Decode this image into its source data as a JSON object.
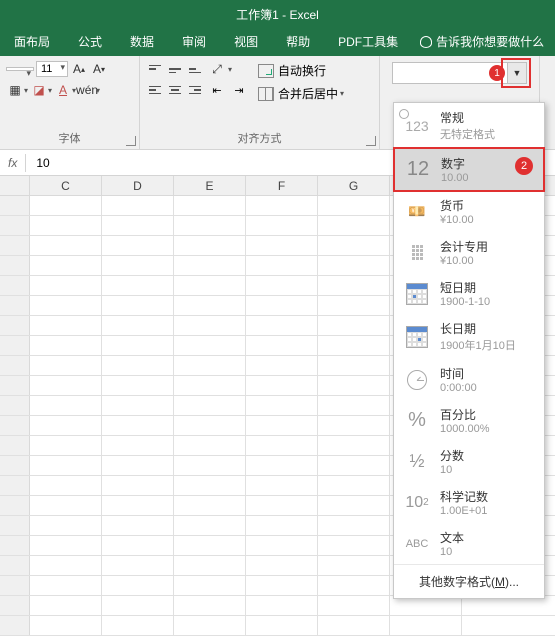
{
  "title": "工作簿1 - Excel",
  "tabs": [
    "面布局",
    "公式",
    "数据",
    "审阅",
    "视图",
    "帮助",
    "PDF工具集"
  ],
  "tell_me": "告诉我你想要做什么",
  "font": {
    "size": "11",
    "group_label": "字体"
  },
  "align": {
    "wrap": "自动换行",
    "merge": "合并后居中",
    "group_label": "对齐方式"
  },
  "formula": {
    "fx": "fx",
    "value": "10"
  },
  "columns": [
    "",
    "C",
    "D",
    "E",
    "F",
    "G"
  ],
  "callouts": {
    "one": "1",
    "two": "2"
  },
  "formats": [
    {
      "key": "general",
      "title": "常规",
      "sub": "无特定格式"
    },
    {
      "key": "number",
      "title": "数字",
      "sub": "10.00"
    },
    {
      "key": "currency",
      "title": "货币",
      "sub": "¥10.00"
    },
    {
      "key": "accounting",
      "title": "会计专用",
      "sub": "¥10.00"
    },
    {
      "key": "shortdate",
      "title": "短日期",
      "sub": "1900-1-10"
    },
    {
      "key": "longdate",
      "title": "长日期",
      "sub": "1900年1月10日"
    },
    {
      "key": "time",
      "title": "时间",
      "sub": "0:00:00"
    },
    {
      "key": "percent",
      "title": "百分比",
      "sub": "1000.00%"
    },
    {
      "key": "fraction",
      "title": "分数",
      "sub": "10"
    },
    {
      "key": "scientific",
      "title": "科学记数",
      "sub": "1.00E+01"
    },
    {
      "key": "text",
      "title": "文本",
      "sub": "10"
    }
  ],
  "icon_samples": {
    "general": "123",
    "number": "12",
    "percent": "%",
    "fraction": "½",
    "text": "ABC",
    "sci_base": "10",
    "sci_exp": "2"
  },
  "more": {
    "prefix": "其他数字格式(",
    "key": "M",
    "suffix": ")..."
  }
}
